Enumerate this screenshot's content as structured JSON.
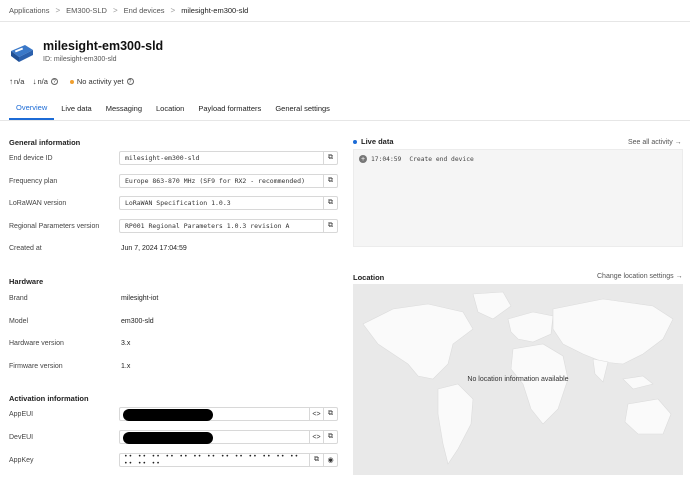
{
  "breadcrumb": {
    "items": [
      "Applications",
      "EM300-SLD",
      "End devices"
    ],
    "current": "milesight-em300-sld",
    "separator": ">"
  },
  "header": {
    "title": "milesight-em300-sld",
    "id_text": "ID: milesight-em300-sld",
    "uplink": "n/a",
    "downlink": "n/a",
    "activity": "No activity yet",
    "activity_color": "#f0a030"
  },
  "tabs": [
    {
      "label": "Overview",
      "active": true
    },
    {
      "label": "Live data"
    },
    {
      "label": "Messaging"
    },
    {
      "label": "Location"
    },
    {
      "label": "Payload formatters"
    },
    {
      "label": "General settings"
    }
  ],
  "general": {
    "heading": "General information",
    "end_device_id_label": "End device ID",
    "end_device_id": "milesight-em300-sld",
    "frequency_plan_label": "Frequency plan",
    "frequency_plan": "Europe 863-870 MHz (SF9 for RX2 - recommended)",
    "lorawan_version_label": "LoRaWAN version",
    "lorawan_version": "LoRaWAN Specification 1.0.3",
    "regional_params_label": "Regional Parameters version",
    "regional_params": "RP001 Regional Parameters 1.0.3 revision A",
    "created_at_label": "Created at",
    "created_at": "Jun 7, 2024 17:04:59"
  },
  "hardware": {
    "heading": "Hardware",
    "brand_label": "Brand",
    "brand": "milesight-iot",
    "model_label": "Model",
    "model": "em300-sld",
    "hw_version_label": "Hardware version",
    "hw_version": "3.x",
    "fw_version_label": "Firmware version",
    "fw_version": "1.x"
  },
  "activation": {
    "heading": "Activation information",
    "appeui_label": "AppEUI",
    "deveui_label": "DevEUI",
    "appkey_label": "AppKey",
    "appkey_masked": "•• •• •• •• •• •• •• •• •• •• •• •• •• •• •• ••"
  },
  "live_data": {
    "heading": "Live data",
    "see_all": "See all activity →",
    "events": [
      {
        "time": "17:04:59",
        "text": "Create end device"
      }
    ],
    "accent": "#1c6bd6"
  },
  "location": {
    "heading": "Location",
    "change_link": "Change location settings →",
    "empty_message": "No location information available"
  },
  "icons": {
    "copy": "copy-icon",
    "code": "code-icon",
    "eye": "eye-icon",
    "up": "arrow-up-icon",
    "down": "arrow-down-icon",
    "help": "help-circle-icon",
    "device": "device-icon",
    "plus": "plus-circle-icon"
  }
}
